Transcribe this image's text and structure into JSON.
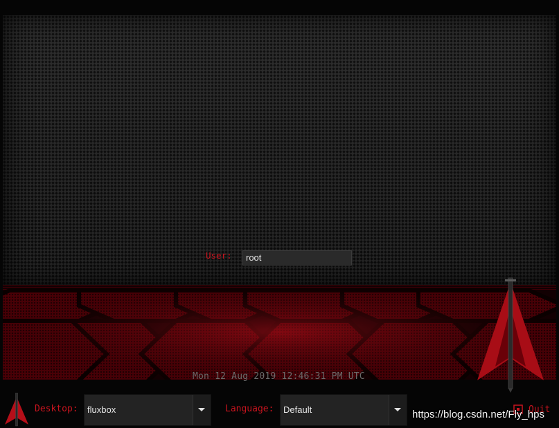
{
  "login": {
    "user_label": "User:",
    "user_value": "root"
  },
  "clock": "Mon 12 Aug 2019 12:46:31 PM UTC",
  "bottom_bar": {
    "desktop_label": "Desktop:",
    "desktop_value": "fluxbox",
    "language_label": "Language:",
    "language_value": "Default",
    "quit_label": "Quit"
  },
  "watermark": "https://blog.csdn.net/Fly_hps",
  "icons": [
    "blackarch-logo-icon",
    "dropdown-arrow-icon",
    "quit-icon"
  ],
  "colors": {
    "accent": "#c8141e",
    "background": "#000000",
    "panel": "#1c1c1c",
    "band": "#5a0008"
  }
}
